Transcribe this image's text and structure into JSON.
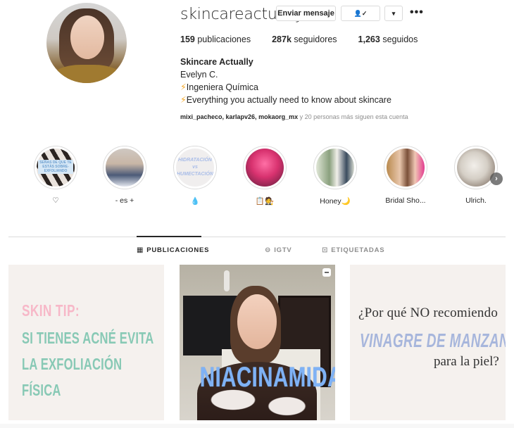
{
  "profile": {
    "username": "skincareactually",
    "buttons": {
      "message": "Enviar mensaje",
      "following_icon": "👤✓",
      "dropdown_icon": "▾",
      "more_icon": "•••"
    },
    "stats": {
      "posts_count": "159",
      "posts_label": "publicaciones",
      "followers_count": "287k",
      "followers_label": "seguidores",
      "following_count": "1,263",
      "following_label": "seguidos"
    },
    "bio": {
      "full_name": "Skincare Actually",
      "line1": "Evelyn C.",
      "line2_icon": "⚡",
      "line2": "Ingeniera Química",
      "line3_icon": "⚡",
      "line3": "Everything you actually need to know about skincare"
    },
    "followed_by": {
      "names": "mixi_pacheco, karlapv26, mokaorg_mx",
      "suffix": " y 20 personas más siguen esta cuenta"
    }
  },
  "highlights": [
    {
      "label": "♡",
      "image_text": "SEÑAS DE QUE TE ESTÁS SOBRE-EXFOLIANDO"
    },
    {
      "label": "- es +"
    },
    {
      "label": "💧",
      "image_text": "HIDRATACIÓN vs HUMECTACIÓN"
    },
    {
      "label": "📋🧑‍⚖️"
    },
    {
      "label": "Honey🌙"
    },
    {
      "label": "Bridal Sho..."
    },
    {
      "label": "Ulrich."
    }
  ],
  "highlights_next_icon": "›",
  "tabs": [
    {
      "icon": "▦",
      "label": "PUBLICACIONES",
      "active": true
    },
    {
      "icon": "⊖",
      "label": "IGTV",
      "active": false
    },
    {
      "icon": "⊡",
      "label": "ETIQUETADAS",
      "active": false
    }
  ],
  "posts": [
    {
      "type": "image",
      "title": "SKIN TIP:",
      "text": "SI TIENES ACNÉ EVITA LA EXFOLIACIÓN FÍSICA"
    },
    {
      "type": "igtv",
      "text": "NIACINAMIDA"
    },
    {
      "type": "image",
      "line1": "¿Por qué NO recomiendo",
      "line2": "VINAGRE DE MANZANA",
      "line3": "para la piel?"
    }
  ],
  "colors": {
    "pink": "#f7b8c8",
    "mint": "#88c9b5",
    "blue": "#7fb2f5",
    "lavender": "#a7b6dc"
  }
}
